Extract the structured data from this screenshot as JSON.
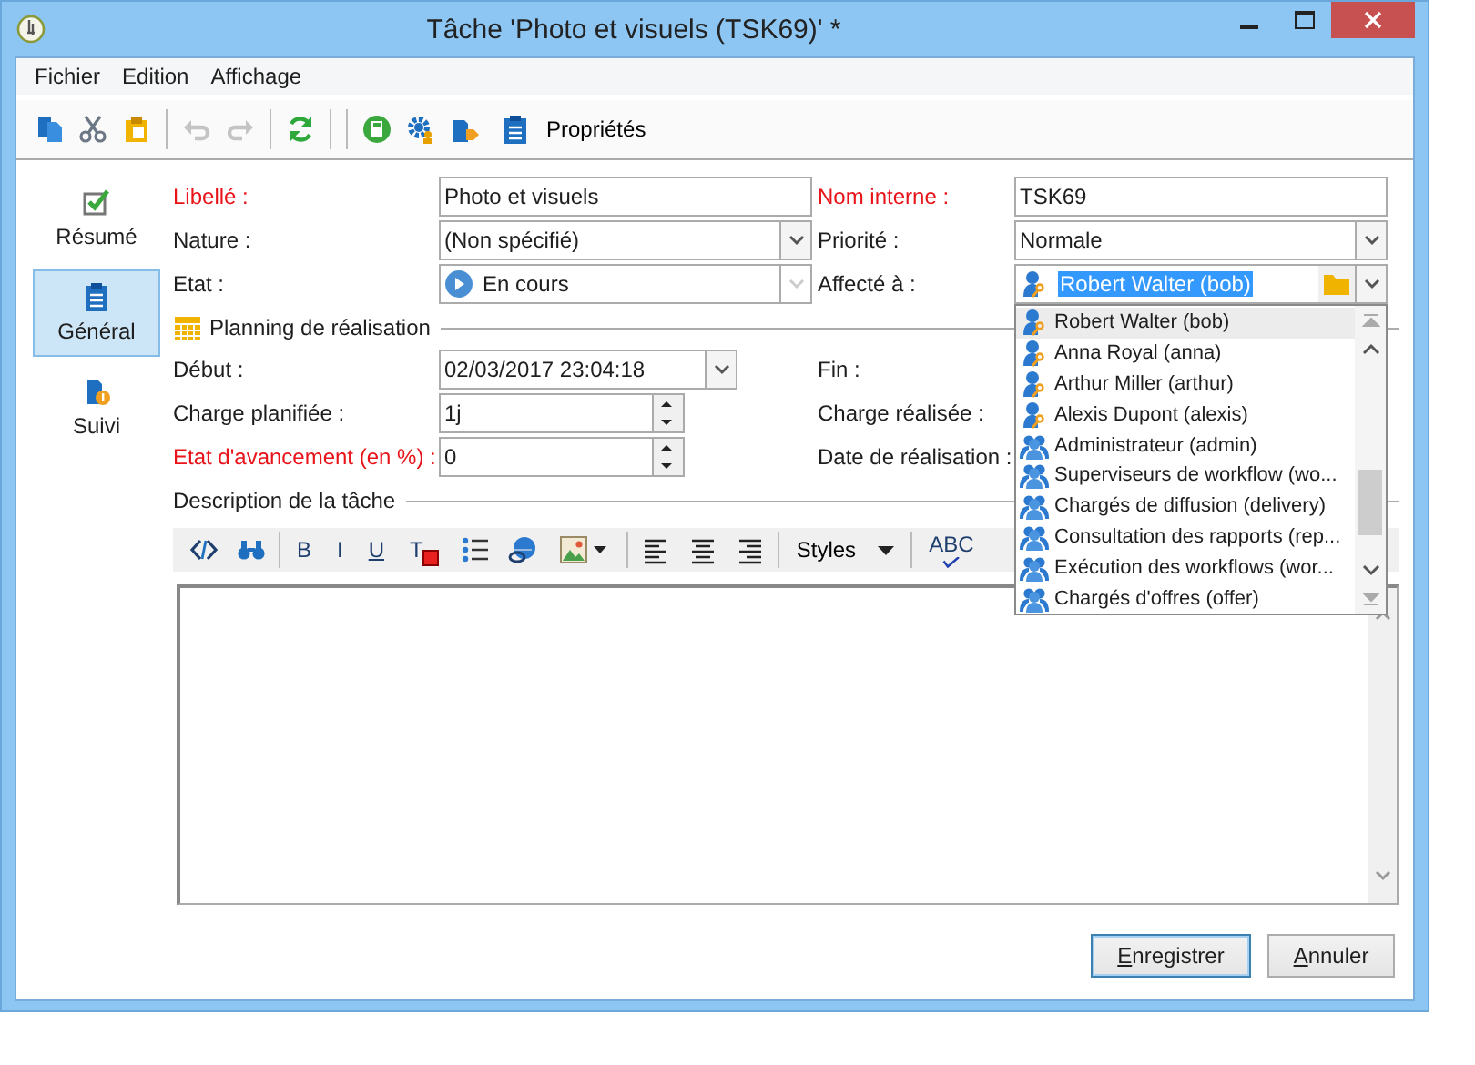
{
  "window": {
    "title": "Tâche 'Photo et visuels (TSK69)' *"
  },
  "menu": [
    "Fichier",
    "Edition",
    "Affichage"
  ],
  "toolbar": [
    {
      "kind": "copy",
      "disabled": false
    },
    {
      "kind": "cut",
      "disabled": false
    },
    {
      "kind": "paste",
      "disabled": false
    },
    {
      "kind": "separator"
    },
    {
      "kind": "undo",
      "disabled": true
    },
    {
      "kind": "redo",
      "disabled": true
    },
    {
      "kind": "separator"
    },
    {
      "kind": "refresh",
      "disabled": false
    },
    {
      "kind": "separator"
    },
    {
      "kind": "separator"
    },
    {
      "kind": "calculator",
      "disabled": false
    },
    {
      "kind": "gear",
      "disabled": false
    },
    {
      "kind": "tag",
      "disabled": false
    },
    {
      "kind": "properties",
      "label": "Propriétés",
      "disabled": false
    }
  ],
  "sidebar": [
    {
      "kind": "summary",
      "label": "Résumé",
      "selected": false
    },
    {
      "kind": "general",
      "label": "Général",
      "selected": true
    },
    {
      "kind": "tracking",
      "label": "Suivi",
      "selected": false
    }
  ],
  "fields": [
    {
      "label": "Libellé :",
      "required": true,
      "kind": "text",
      "value": "Photo et visuels"
    },
    {
      "label": "Nom interne :",
      "required": true,
      "kind": "text",
      "value": "TSK69"
    },
    {
      "label": "Nature :",
      "required": false,
      "kind": "combo",
      "value": "(Non spécifié)",
      "disabled": false
    },
    {
      "label": "Priorité :",
      "required": false,
      "kind": "combo",
      "value": "Normale",
      "disabled": false
    },
    {
      "label": "Etat :",
      "required": false,
      "kind": "status",
      "value": "En cours",
      "disabled": true
    },
    {
      "label": "Affecté à :",
      "required": false,
      "kind": "assignee",
      "value": "Robert Walter (bob)",
      "highlighted": true
    }
  ],
  "planning": {
    "title": "Planning de réalisation",
    "fields": [
      {
        "label": "Début :",
        "required": false,
        "kind": "datetime",
        "value": "02/03/2017 23:04:18"
      },
      {
        "label": "Fin :",
        "required": false,
        "kind": "label"
      },
      {
        "label": "Charge planifiée :",
        "required": false,
        "kind": "spin",
        "value": "1j"
      },
      {
        "label": "Charge réalisée :",
        "required": false,
        "kind": "label"
      },
      {
        "label": "Etat d'avancement (en %) :",
        "required": true,
        "kind": "spin",
        "value": "0"
      },
      {
        "label": "Date de réalisation :",
        "required": false,
        "kind": "label"
      }
    ]
  },
  "description": {
    "title": "Description de la tâche",
    "toolbar": [
      {
        "kind": "source"
      },
      {
        "kind": "find"
      },
      {
        "kind": "separator"
      },
      {
        "kind": "bold",
        "label": "B"
      },
      {
        "kind": "italic",
        "label": "I"
      },
      {
        "kind": "underline",
        "label": "U"
      },
      {
        "kind": "text_color",
        "label": "T"
      },
      {
        "kind": "list"
      },
      {
        "kind": "link"
      },
      {
        "kind": "image"
      },
      {
        "kind": "separator"
      },
      {
        "kind": "align_left"
      },
      {
        "kind": "align_center"
      },
      {
        "kind": "align_right"
      },
      {
        "kind": "separator"
      },
      {
        "kind": "styles",
        "label": "Styles"
      },
      {
        "kind": "separator"
      },
      {
        "kind": "spellcheck",
        "label": "ABC"
      }
    ]
  },
  "assignee_list": [
    {
      "kind": "user",
      "label": "Robert Walter (bob)",
      "selected": true
    },
    {
      "kind": "user",
      "label": "Anna Royal (anna)",
      "selected": false
    },
    {
      "kind": "user",
      "label": "Arthur Miller (arthur)",
      "selected": false
    },
    {
      "kind": "user",
      "label": "Alexis Dupont (alexis)",
      "selected": false
    },
    {
      "kind": "group",
      "label": "Administrateur (admin)",
      "selected": false
    },
    {
      "kind": "group",
      "label": "Superviseurs de workflow (wo...",
      "selected": false
    },
    {
      "kind": "group",
      "label": "Chargés de diffusion (delivery)",
      "selected": false
    },
    {
      "kind": "group",
      "label": "Consultation des rapports (rep...",
      "selected": false
    },
    {
      "kind": "group",
      "label": "Exécution des workflows (wor...",
      "selected": false
    },
    {
      "kind": "group",
      "label": "Chargés d'offres (offer)",
      "selected": false
    }
  ],
  "buttons": [
    {
      "label": "Enregistrer",
      "default": true
    },
    {
      "label": "Annuler",
      "default": false
    }
  ]
}
